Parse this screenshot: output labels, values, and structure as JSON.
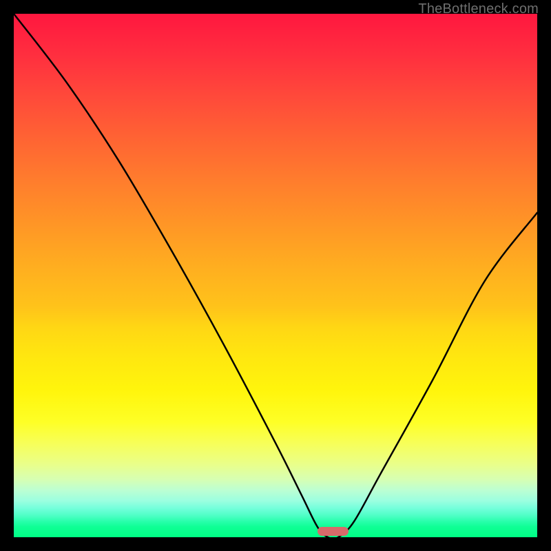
{
  "watermark": {
    "text": "TheBottleneck.com"
  },
  "chart_data": {
    "type": "line",
    "title": "",
    "xlabel": "",
    "ylabel": "",
    "xlim": [
      0,
      100
    ],
    "ylim": [
      0,
      100
    ],
    "grid": false,
    "series": [
      {
        "name": "bottleneck-curve",
        "x": [
          0,
          10,
          20,
          30,
          40,
          50,
          55,
          58,
          60,
          62,
          65,
          70,
          80,
          90,
          100
        ],
        "values": [
          100,
          87,
          72,
          55,
          37,
          18,
          8,
          2,
          0,
          0,
          3,
          12,
          30,
          49,
          62
        ]
      }
    ],
    "marker": {
      "name": "best-fit-pill",
      "x_range": [
        58,
        64
      ],
      "y": 0,
      "color": "#d76a6a"
    },
    "background_gradient": {
      "top": "#ff173f",
      "bottom": "#00ff85"
    }
  }
}
